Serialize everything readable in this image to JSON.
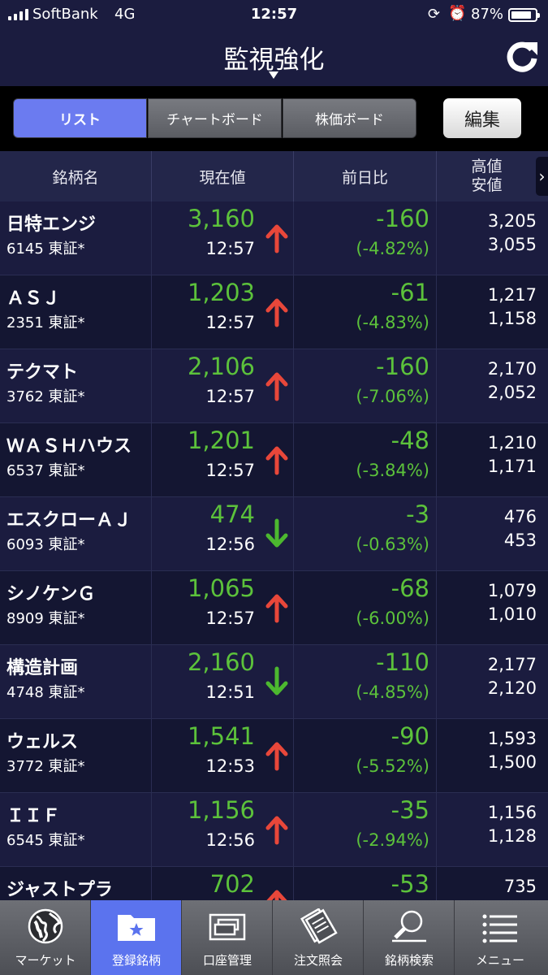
{
  "status": {
    "carrier": "SoftBank",
    "network": "4G",
    "time": "12:57",
    "battery": "87%",
    "battery_level": 0.87
  },
  "nav": {
    "title": "監視強化"
  },
  "segments": [
    {
      "label": "リスト",
      "active": true
    },
    {
      "label": "チャートボード",
      "active": false
    },
    {
      "label": "株価ボード",
      "active": false
    }
  ],
  "edit_label": "編集",
  "table": {
    "headers": {
      "name": "銘柄名",
      "price": "現在値",
      "change": "前日比",
      "high": "高値",
      "low": "安値"
    },
    "rows": [
      {
        "name": "日特エンジ",
        "code": "6145 東証*",
        "price": "3,160",
        "time": "12:57",
        "trend": "up",
        "change": "-160",
        "change_pct": "(-4.82%)",
        "high": "3,205",
        "low": "3,055"
      },
      {
        "name": "ＡＳＪ",
        "code": "2351 東証*",
        "price": "1,203",
        "time": "12:57",
        "trend": "up",
        "change": "-61",
        "change_pct": "(-4.83%)",
        "high": "1,217",
        "low": "1,158"
      },
      {
        "name": "テクマト",
        "code": "3762 東証*",
        "price": "2,106",
        "time": "12:57",
        "trend": "up",
        "change": "-160",
        "change_pct": "(-7.06%)",
        "high": "2,170",
        "low": "2,052"
      },
      {
        "name": "ＷＡＳＨハウス",
        "code": "6537 東証*",
        "price": "1,201",
        "time": "12:57",
        "trend": "up",
        "change": "-48",
        "change_pct": "(-3.84%)",
        "high": "1,210",
        "low": "1,171"
      },
      {
        "name": "エスクローＡＪ",
        "code": "6093 東証*",
        "price": "474",
        "time": "12:56",
        "trend": "down",
        "change": "-3",
        "change_pct": "(-0.63%)",
        "high": "476",
        "low": "453"
      },
      {
        "name": "シノケンＧ",
        "code": "8909 東証*",
        "price": "1,065",
        "time": "12:57",
        "trend": "up",
        "change": "-68",
        "change_pct": "(-6.00%)",
        "high": "1,079",
        "low": "1,010"
      },
      {
        "name": "構造計画",
        "code": "4748 東証*",
        "price": "2,160",
        "time": "12:51",
        "trend": "down",
        "change": "-110",
        "change_pct": "(-4.85%)",
        "high": "2,177",
        "low": "2,120"
      },
      {
        "name": "ウェルス",
        "code": "3772 東証*",
        "price": "1,541",
        "time": "12:53",
        "trend": "up",
        "change": "-90",
        "change_pct": "(-5.52%)",
        "high": "1,593",
        "low": "1,500"
      },
      {
        "name": "ＩＩＦ",
        "code": "6545 東証*",
        "price": "1,156",
        "time": "12:56",
        "trend": "up",
        "change": "-35",
        "change_pct": "(-2.94%)",
        "high": "1,156",
        "low": "1,128"
      },
      {
        "name": "ジャストプラ",
        "code": "",
        "price": "702",
        "time": "",
        "trend": "up",
        "change": "-53",
        "change_pct": "",
        "high": "735",
        "low": ""
      }
    ]
  },
  "tabs": [
    {
      "label": "マーケット",
      "icon": "globe-icon",
      "active": false
    },
    {
      "label": "登録銘柄",
      "icon": "star-folder-icon",
      "active": true
    },
    {
      "label": "口座管理",
      "icon": "cards-icon",
      "active": false
    },
    {
      "label": "注文照会",
      "icon": "documents-icon",
      "active": false
    },
    {
      "label": "銘柄検索",
      "icon": "magnifier-icon",
      "active": false
    },
    {
      "label": "メニュー",
      "icon": "list-menu-icon",
      "active": false
    }
  ],
  "colors": {
    "up_arrow": "#e8473a",
    "down_arrow": "#4cb82f",
    "value_green": "#5cc23b",
    "active_tab": "#5b73ee",
    "active_segment": "#6b7bf0"
  }
}
